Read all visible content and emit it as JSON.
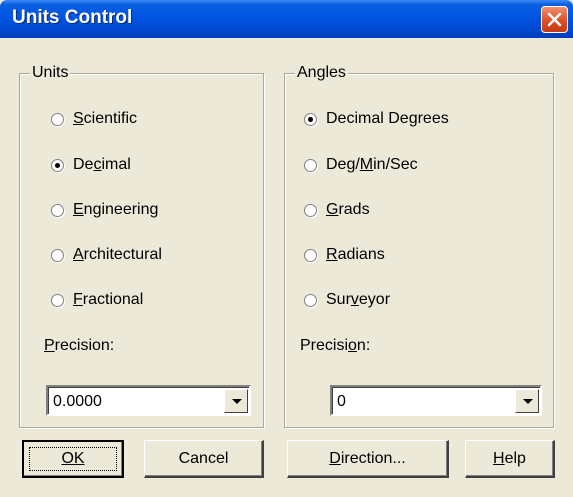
{
  "window": {
    "title": "Units Control",
    "close_glyph": "close-icon"
  },
  "units": {
    "group_label": "Units",
    "options": [
      {
        "label": "Scientific",
        "accel_index": 0,
        "checked": false
      },
      {
        "label": "Decimal",
        "accel_index": 2,
        "checked": true
      },
      {
        "label": "Engineering",
        "accel_index": 0,
        "checked": false
      },
      {
        "label": "Architectural",
        "accel_index": 0,
        "checked": false
      },
      {
        "label": "Fractional",
        "accel_index": 0,
        "checked": false
      }
    ],
    "precision_label": "Precision:",
    "precision_value": "0.0000"
  },
  "angles": {
    "group_label": "Angles",
    "options": [
      {
        "label": "Decimal Degrees",
        "accel_index": -1,
        "checked": true
      },
      {
        "label": "Deg/Min/Sec",
        "accel_index": 4,
        "checked": false
      },
      {
        "label": "Grads",
        "accel_index": 0,
        "checked": false
      },
      {
        "label": "Radians",
        "accel_index": 0,
        "checked": false
      },
      {
        "label": "Surveyor",
        "accel_index": 3,
        "checked": false
      }
    ],
    "precision_label": "Precision:",
    "precision_value": "0"
  },
  "buttons": {
    "ok": "OK",
    "cancel": "Cancel",
    "direction": "Direction...",
    "help": "Help"
  }
}
